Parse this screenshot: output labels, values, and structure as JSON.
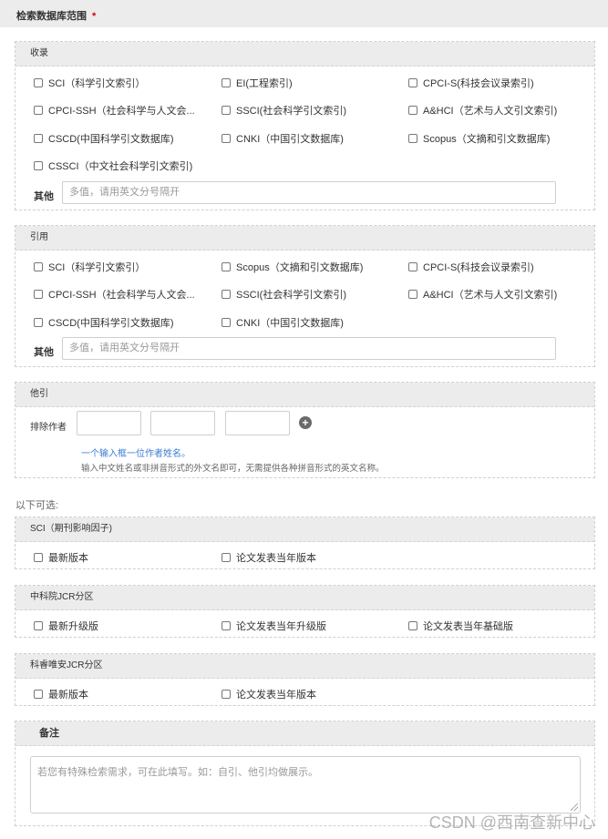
{
  "header": {
    "title": "检索数据库范围",
    "required_mark": "*"
  },
  "shoulu": {
    "title": "收录",
    "options": [
      "SCI（科学引文索引）",
      "EI(工程索引)",
      "CPCI-S(科技会议录索引)",
      "CPCI-SSH（社会科学与人文会...",
      "SSCI(社会科学引文索引)",
      "A&HCI（艺术与人文引文索引)",
      "CSCD(中国科学引文数据库)",
      "CNKI（中国引文数据库)",
      "Scopus（文摘和引文数据库)",
      "CSSCI（中文社会科学引文索引)"
    ],
    "other_label": "其他",
    "other_placeholder": "多值，请用英文分号隔开"
  },
  "yinyong": {
    "title": "引用",
    "options": [
      "SCI（科学引文索引）",
      "Scopus（文摘和引文数据库)",
      "CPCI-S(科技会议录索引)",
      "CPCI-SSH（社会科学与人文会...",
      "SSCI(社会科学引文索引)",
      "A&HCI（艺术与人文引文索引)",
      "CSCD(中国科学引文数据库)",
      "CNKI（中国引文数据库)"
    ],
    "other_label": "其他",
    "other_placeholder": "多值，请用英文分号隔开"
  },
  "tayin": {
    "title": "他引",
    "exclude_label": "排除作者",
    "add_symbol": "+",
    "hint_blue": "一个输入框一位作者姓名。",
    "hint_gray": "输入中文姓名或非拼音形式的外文名即可，无需提供各种拼音形式的英文名称。"
  },
  "optional_label": "以下可选:",
  "sci_if": {
    "title": "SCI（期刊影响因子)",
    "options": [
      "最新版本",
      "论文发表当年版本"
    ]
  },
  "cas_jcr": {
    "title": "中科院JCR分区",
    "options": [
      "最新升级版",
      "论文发表当年升级版",
      "论文发表当年基础版"
    ]
  },
  "clarivate_jcr": {
    "title": "科睿唯安JCR分区",
    "options": [
      "最新版本",
      "论文发表当年版本"
    ]
  },
  "notes": {
    "title": "备注",
    "placeholder": "若您有特殊检索需求，可在此填写。如：自引、他引均做展示。"
  },
  "watermark": "CSDN @西南查新中心"
}
